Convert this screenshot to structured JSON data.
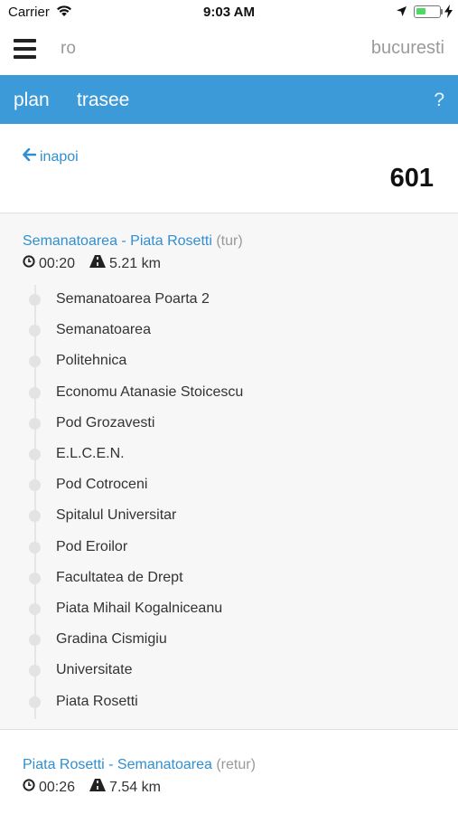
{
  "status_bar": {
    "carrier": "Carrier",
    "time": "9:03 AM"
  },
  "header": {
    "language": "ro",
    "city": "bucuresti"
  },
  "nav": {
    "plan_label": "plan",
    "trasee_label": "trasee",
    "help_label": "?"
  },
  "back_label": "inapoi",
  "line_number": "601",
  "colors": {
    "accent": "#3d9ad9",
    "link": "#2f8fd0",
    "battery": "#4cd964"
  },
  "routes": [
    {
      "name": "Semanatoarea - Piata Rosetti",
      "direction": "(tur)",
      "duration": "00:20",
      "distance": "5.21 km",
      "stops": [
        "Semanatoarea Poarta 2",
        "Semanatoarea",
        "Politehnica",
        "Economu Atanasie Stoicescu",
        "Pod Grozavesti",
        "E.L.C.E.N.",
        "Pod Cotroceni",
        "Spitalul Universitar",
        "Pod Eroilor",
        "Facultatea de Drept",
        "Piata Mihail Kogalniceanu",
        "Gradina Cismigiu",
        "Universitate",
        "Piata Rosetti"
      ]
    },
    {
      "name": "Piata Rosetti - Semanatoarea",
      "direction": "(retur)",
      "duration": "00:26",
      "distance": "7.54 km",
      "stops": []
    }
  ]
}
